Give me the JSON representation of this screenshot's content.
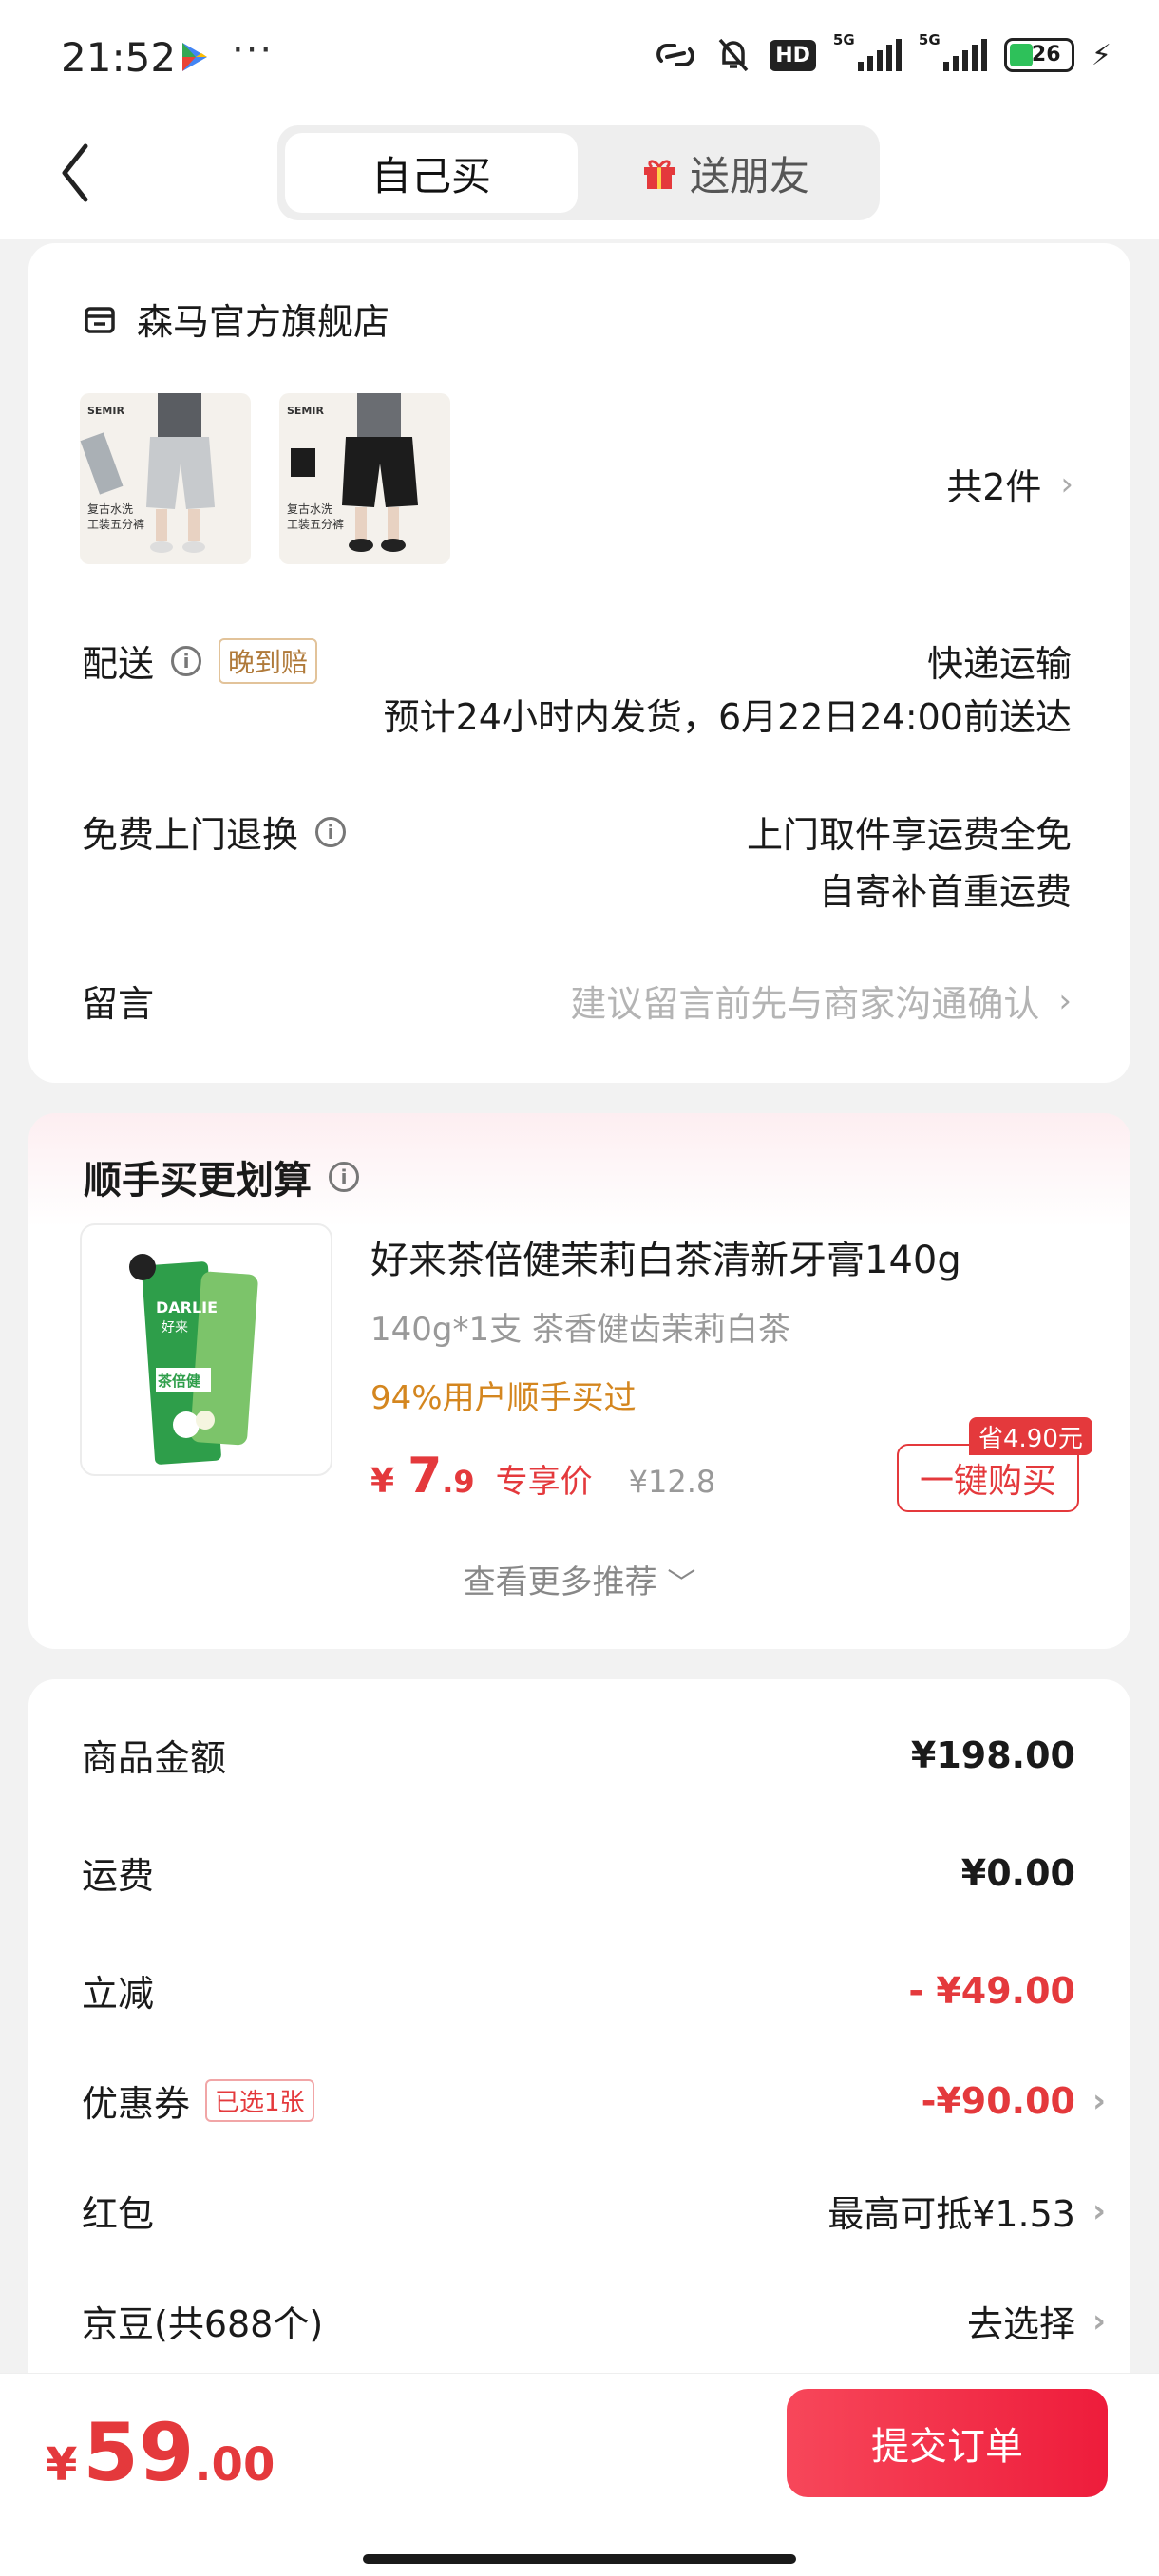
{
  "status_bar": {
    "time": "21:52",
    "more": "···",
    "hd": "HD",
    "net1": "5G",
    "net2": "5G",
    "battery": "26"
  },
  "header": {
    "tab_self": "自己买",
    "tab_gift": "送朋友"
  },
  "order": {
    "store_name": "森马官方旗舰店",
    "thumb_caption": "复古水洗\n工装五分裤",
    "thumb_brand": "SEMIR",
    "item_count": "共2件",
    "delivery_label": "配送",
    "late_tag": "晚到赔",
    "delivery_method": "快递运输",
    "delivery_eta": "预计24小时内发货，6月22日24:00前送达",
    "return_label": "免费上门退换",
    "return_line1": "上门取件享运费全免",
    "return_line2": "自寄补首重运费",
    "message_label": "留言",
    "message_placeholder": "建议留言前先与商家沟通确认"
  },
  "addon": {
    "title": "顺手买更划算",
    "product_name": "好来茶倍健茉莉白茶清新牙膏140g",
    "product_spec": "140g*1支 茶香健齿茉莉白茶",
    "bought_text": "94%用户顺手买过",
    "price_symbol": "¥",
    "price_int": "7",
    "price_dec": ".9",
    "price_label": "专享价",
    "price_old": "¥12.8",
    "save_tag": "省4.90元",
    "buy_button": "一键购买",
    "more": "查看更多推荐",
    "img_brand": "DARLIE",
    "img_brand_cn": "好来",
    "img_series": "茶倍健"
  },
  "fees": {
    "goods_label": "商品金额",
    "goods_value": "¥198.00",
    "shipping_label": "运费",
    "shipping_value": "¥0.00",
    "discount_label": "立减",
    "discount_value": "- ¥49.00",
    "coupon_label": "优惠券",
    "coupon_tag": "已选1张",
    "coupon_value": "-¥90.00",
    "redpacket_label": "红包",
    "redpacket_value": "最高可抵¥1.53",
    "jingdou_label": "京豆(共688个)",
    "jingdou_value": "去选择"
  },
  "footer": {
    "currency": "¥",
    "total_int": "59",
    "total_dec": ".00",
    "submit": "提交订单"
  },
  "colors": {
    "accent": "#e4393c",
    "orange": "#d4861f",
    "bg": "#f2f2f2"
  }
}
